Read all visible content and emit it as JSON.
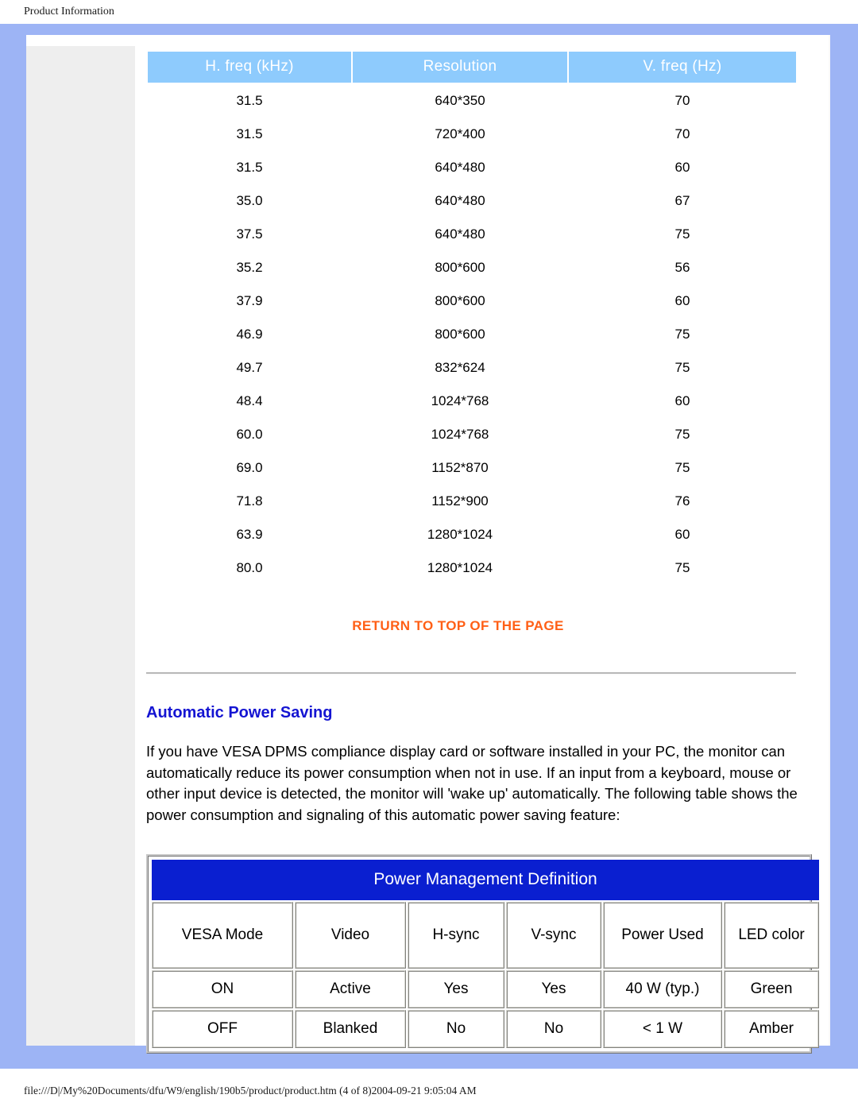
{
  "print_header": {
    "title": "Product Information"
  },
  "print_footer": {
    "text": "file:///D|/My%20Documents/dfu/W9/english/190b5/product/product.htm (4 of 8)2004-09-21 9:05:04 AM"
  },
  "colors": {
    "page_band": "#9db4f5",
    "sidebar": "#eeeeee",
    "table_header": "#8ecbfd",
    "link_orange": "#ff5f16",
    "heading_blue": "#1414d2",
    "pm_title_blue": "#0a1fd0"
  },
  "timing_table": {
    "columns": [
      "H. freq (kHz)",
      "Resolution",
      "V. freq (Hz)"
    ],
    "rows": [
      [
        "31.5",
        "640*350",
        "70"
      ],
      [
        "31.5",
        "720*400",
        "70"
      ],
      [
        "31.5",
        "640*480",
        "60"
      ],
      [
        "35.0",
        "640*480",
        "67"
      ],
      [
        "37.5",
        "640*480",
        "75"
      ],
      [
        "35.2",
        "800*600",
        "56"
      ],
      [
        "37.9",
        "800*600",
        "60"
      ],
      [
        "46.9",
        "800*600",
        "75"
      ],
      [
        "49.7",
        "832*624",
        "75"
      ],
      [
        "48.4",
        "1024*768",
        "60"
      ],
      [
        "60.0",
        "1024*768",
        "75"
      ],
      [
        "69.0",
        "1152*870",
        "75"
      ],
      [
        "71.8",
        "1152*900",
        "76"
      ],
      [
        "63.9",
        "1280*1024",
        "60"
      ],
      [
        "80.0",
        "1280*1024",
        "75"
      ]
    ]
  },
  "return_link": {
    "label": "RETURN TO TOP OF THE PAGE"
  },
  "section": {
    "heading": "Automatic Power Saving",
    "paragraph": "If you have VESA DPMS compliance display card or software installed in your PC, the monitor can automatically reduce its power consumption when not in use. If an input from a keyboard, mouse or other input device is detected, the monitor will 'wake up' automatically. The following table shows the power consumption and signaling of this automatic power saving feature:"
  },
  "power_table": {
    "title": "Power Management Definition",
    "columns": [
      "VESA Mode",
      "Video",
      "H-sync",
      "V-sync",
      "Power Used",
      "LED color"
    ],
    "rows": [
      [
        "ON",
        "Active",
        "Yes",
        "Yes",
        "40 W (typ.)",
        "Green"
      ],
      [
        "OFF",
        "Blanked",
        "No",
        "No",
        "< 1 W",
        "Amber"
      ]
    ]
  }
}
